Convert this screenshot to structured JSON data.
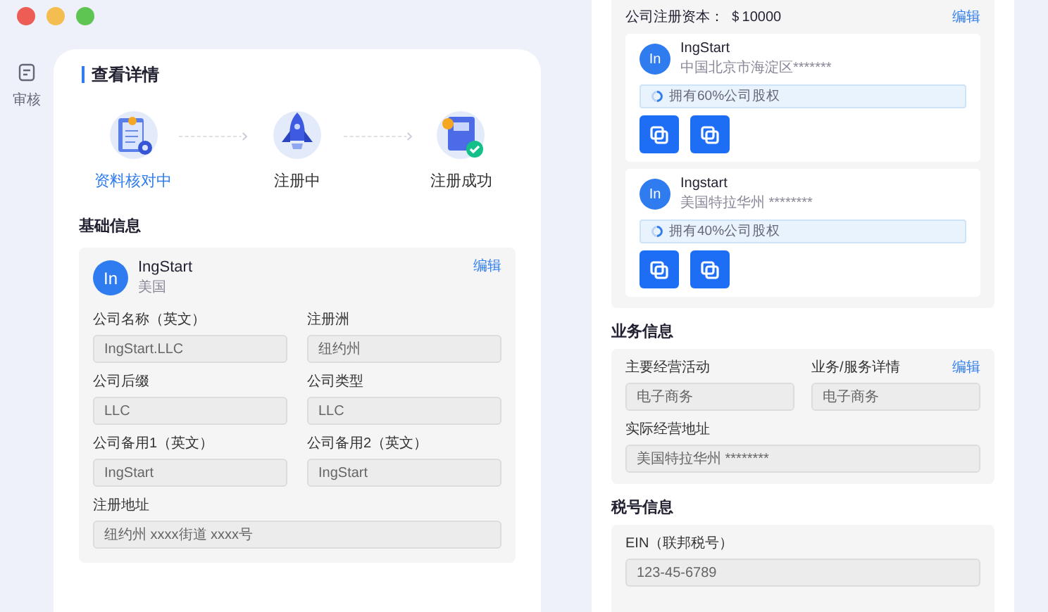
{
  "sidebar": {
    "items": [
      {
        "label": "审核"
      }
    ]
  },
  "detail": {
    "title": "查看详情",
    "steps": [
      {
        "label": "资料核对中",
        "selected": true,
        "kind": "review"
      },
      {
        "label": "注册中",
        "selected": false,
        "kind": "rocket"
      },
      {
        "label": "注册成功",
        "selected": false,
        "kind": "success"
      }
    ],
    "basic_info": {
      "heading": "基础信息",
      "edit_link": "编辑",
      "company": {
        "avatar": "In",
        "name": "IngStart",
        "country": "美国"
      },
      "fields": [
        {
          "label": "公司名称（英文）",
          "value": "IngStart.LLC",
          "kind": "half"
        },
        {
          "label": "注册洲",
          "value": "纽约州",
          "kind": "half"
        },
        {
          "label": "公司后缀",
          "value": "LLC",
          "kind": "half"
        },
        {
          "label": "公司类型",
          "value": "LLC",
          "kind": "half"
        },
        {
          "label": "公司备用1（英文）",
          "value": "IngStart",
          "kind": "half"
        },
        {
          "label": "公司备用2（英文）",
          "value": "IngStart",
          "kind": "half"
        },
        {
          "label": "注册地址",
          "value": "纽约州 xxxx街道 xxxx号",
          "kind": "wide"
        }
      ]
    }
  },
  "shareholders_section": {
    "capital_label": "公司注册资本：",
    "capital_value": "＄10000",
    "edit_link": "编辑",
    "shareholders": [
      {
        "avatar": "In",
        "name": "IngStart",
        "address": "中国北京市海淀区*******",
        "share": "拥有60%公司股权"
      },
      {
        "avatar": "In",
        "name": "Ingstart",
        "address": "美国特拉华州 ********",
        "share": "拥有40%公司股权"
      }
    ]
  },
  "business_info": {
    "heading": "业务信息",
    "edit_link": "编辑",
    "fields": [
      {
        "label": "主要经营活动",
        "value": "电子商务",
        "kind": "half"
      },
      {
        "label": "业务/服务详情",
        "value": "电子商务",
        "kind": "half"
      },
      {
        "label": "实际经营地址",
        "value": "美国特拉华州 ********",
        "kind": "wide"
      }
    ]
  },
  "tax_info": {
    "heading": "税号信息",
    "fields": [
      {
        "label": "EIN（联邦税号）",
        "value": "123-45-6789",
        "kind": "wide"
      }
    ]
  }
}
